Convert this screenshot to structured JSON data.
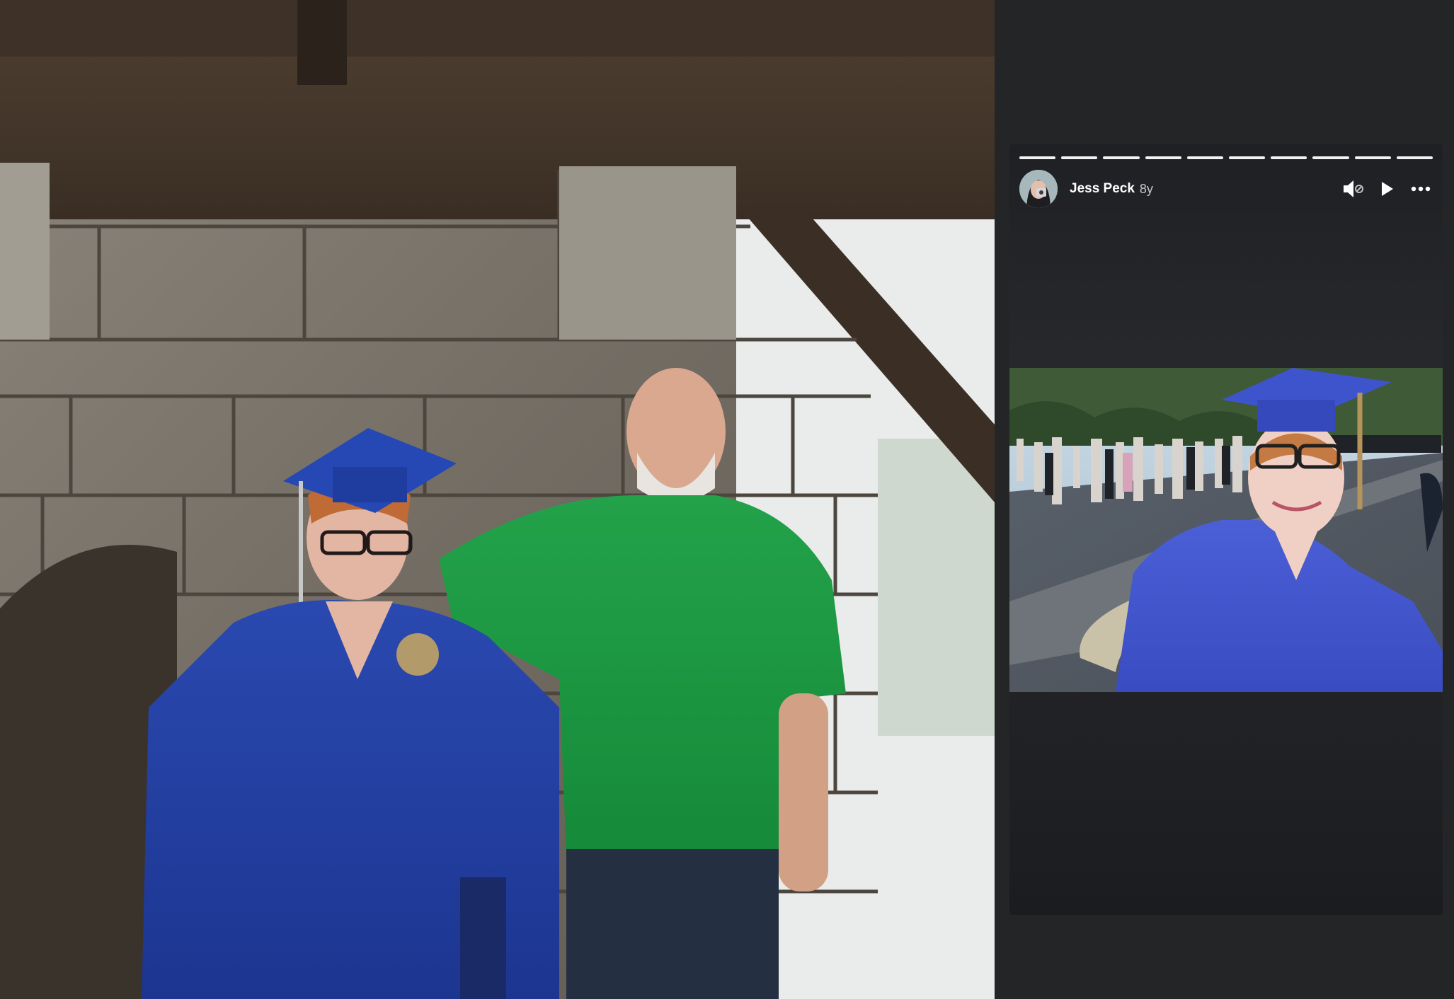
{
  "story": {
    "author_name": "Jess Peck",
    "post_age": "8y",
    "progress_segment_count": 10,
    "controls": {
      "mute_icon": "speaker-muted-icon",
      "play_icon": "play-icon",
      "more_icon": "more-options-icon"
    }
  },
  "colors": {
    "panel_background": "#242527",
    "story_background": "#25262a",
    "progress_bar": "#f2f2f2",
    "author_text": "#ffffff",
    "age_text": "#c9cacd"
  }
}
